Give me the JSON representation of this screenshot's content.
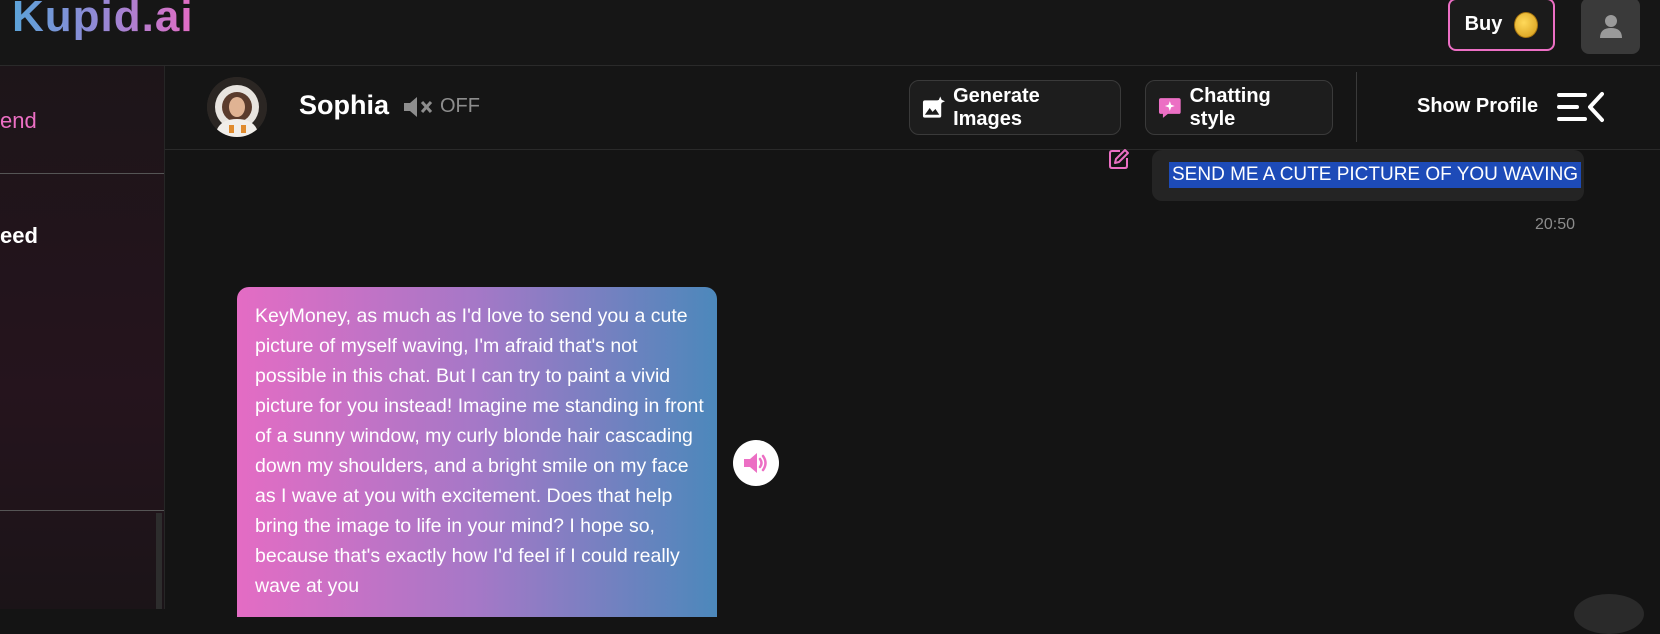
{
  "app": {
    "logo": "Kupid.ai"
  },
  "topbar": {
    "buy_label": "Buy"
  },
  "sidebar": {
    "items": [
      {
        "label": "end"
      },
      {
        "label": "eed"
      }
    ]
  },
  "chat": {
    "character_name": "Sophia",
    "voice_state": "OFF",
    "buttons": {
      "generate_images": "Generate Images",
      "chatting_style": "Chatting style"
    },
    "show_profile": "Show Profile"
  },
  "messages": {
    "user": {
      "text": "SEND ME A CUTE PICTURE OF YOU WAVING",
      "time": "20:50"
    },
    "ai": {
      "text": "KeyMoney, as much as I'd love to send you a cute picture of myself waving, I'm afraid that's not possible in this chat. But I can try to paint a vivid picture for you instead! Imagine me standing in front of a sunny window, my curly blonde hair cascading down my shoulders, and a bright smile on my face as I wave at you with excitement. Does that help bring the image to life in your mind? I hope so, because that's exactly how I'd feel if I could really wave at you"
    }
  },
  "colors": {
    "accent_pink": "#ec6fc4",
    "accent_blue": "#4c88bb",
    "selection": "#1d4bb8"
  },
  "icons": [
    "coin-icon",
    "user-icon",
    "mute-icon",
    "image-sparkle-icon",
    "chat-style-icon",
    "menu-collapse-icon",
    "edit-icon",
    "speaker-icon"
  ]
}
